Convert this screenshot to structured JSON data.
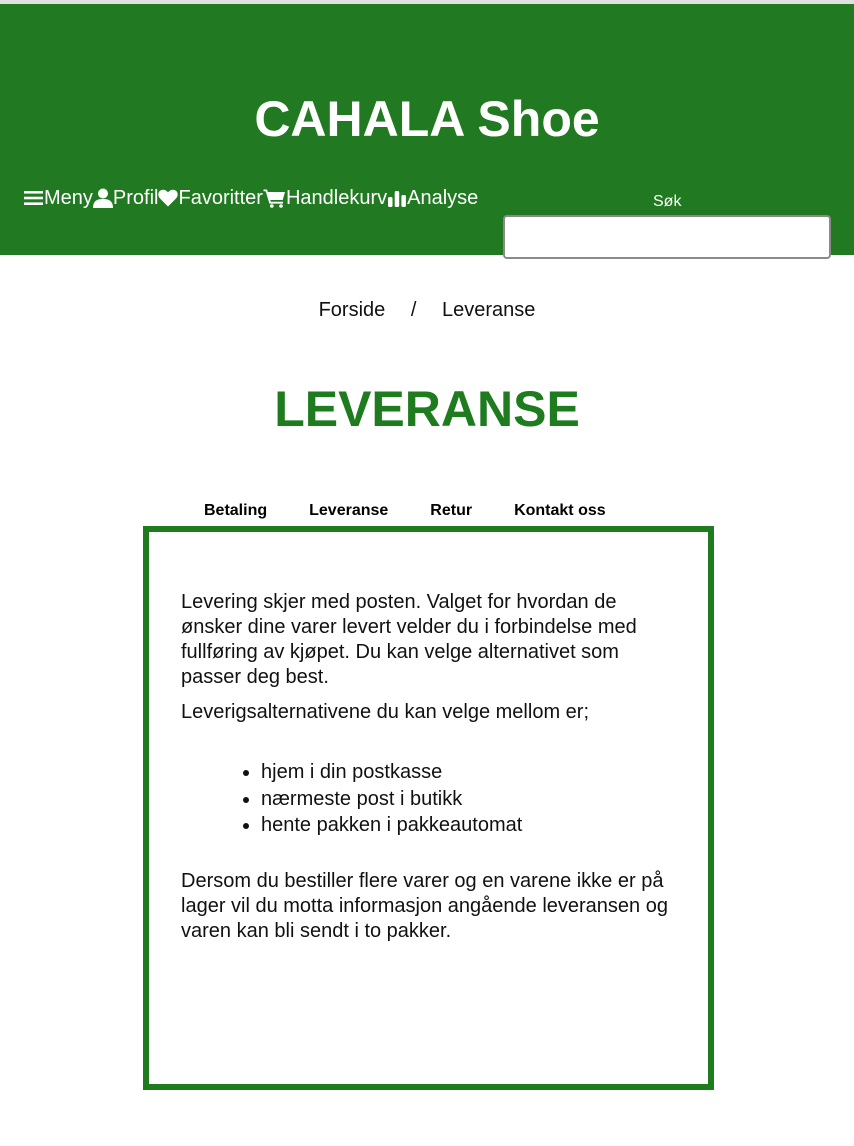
{
  "header": {
    "site_title": "CAHALA Shoe",
    "nav": [
      {
        "icon": "menu-icon",
        "label": "Meny"
      },
      {
        "icon": "user-icon",
        "label": "Profil"
      },
      {
        "icon": "heart-icon",
        "label": "Favoritter"
      },
      {
        "icon": "cart-icon",
        "label": "Handlekurv"
      },
      {
        "icon": "bar-chart-icon",
        "label": "Analyse"
      }
    ],
    "search": {
      "label": "Søk",
      "value": "",
      "placeholder": ""
    }
  },
  "breadcrumb": {
    "home": "Forside",
    "separator": "/",
    "current": "Leveranse"
  },
  "page_title": "LEVERANSE",
  "tabs": [
    "Betaling",
    "Leveranse",
    "Retur",
    "Kontakt oss"
  ],
  "content": {
    "intro": "Levering skjer med posten. Valget for hvordan de ønsker dine varer levert velder du i forbindelse med fullføring av kjøpet. Du kan velge alternativet som passer deg best.",
    "alternatives_intro": "Leverigsalternativene du kan velge mellom er;",
    "options": [
      "hjem i din postkasse",
      "nærmeste post i butikk",
      "hente pakken i pakkeautomat"
    ],
    "note": "Dersom du bestiller flere varer og en varene ikke er på lager vil du motta informasjon angående leveransen og varen kan bli sendt i to pakker."
  },
  "colors": {
    "header_bg": "#217a21",
    "accent_green": "#1e7b1e",
    "text": "#111111"
  }
}
